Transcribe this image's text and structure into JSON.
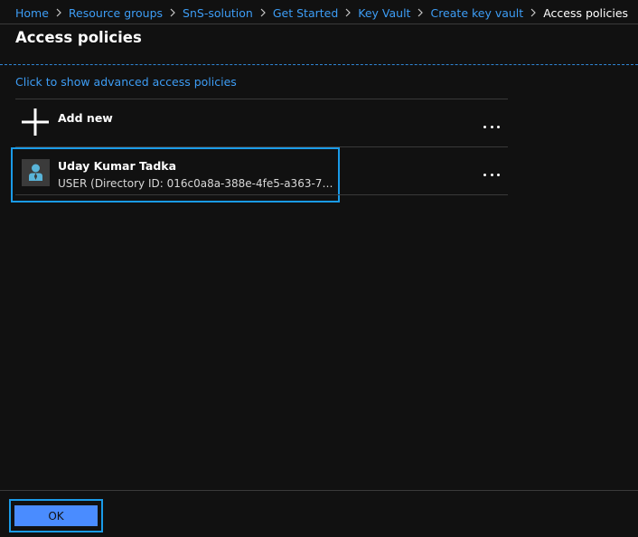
{
  "breadcrumb": {
    "items": [
      {
        "label": "Home"
      },
      {
        "label": "Resource groups"
      },
      {
        "label": "SnS-solution"
      },
      {
        "label": "Get Started"
      },
      {
        "label": "Key Vault"
      },
      {
        "label": "Create key vault"
      }
    ],
    "current": "Access policies"
  },
  "page": {
    "title": "Access policies"
  },
  "advanced_link": "Click to show advanced access policies",
  "add_new": {
    "label": "Add new",
    "icon": "plus-icon"
  },
  "policies": [
    {
      "name": "Uday Kumar Tadka",
      "detail": "USER (Directory ID: 016c0a8a-388e-4fe5-a363-7a...",
      "icon": "user-icon"
    }
  ],
  "footer": {
    "ok_label": "OK"
  },
  "colors": {
    "background": "#111111",
    "link": "#3d9df5",
    "focus_outline": "#1a9be8",
    "primary_button": "#4a8cff"
  }
}
